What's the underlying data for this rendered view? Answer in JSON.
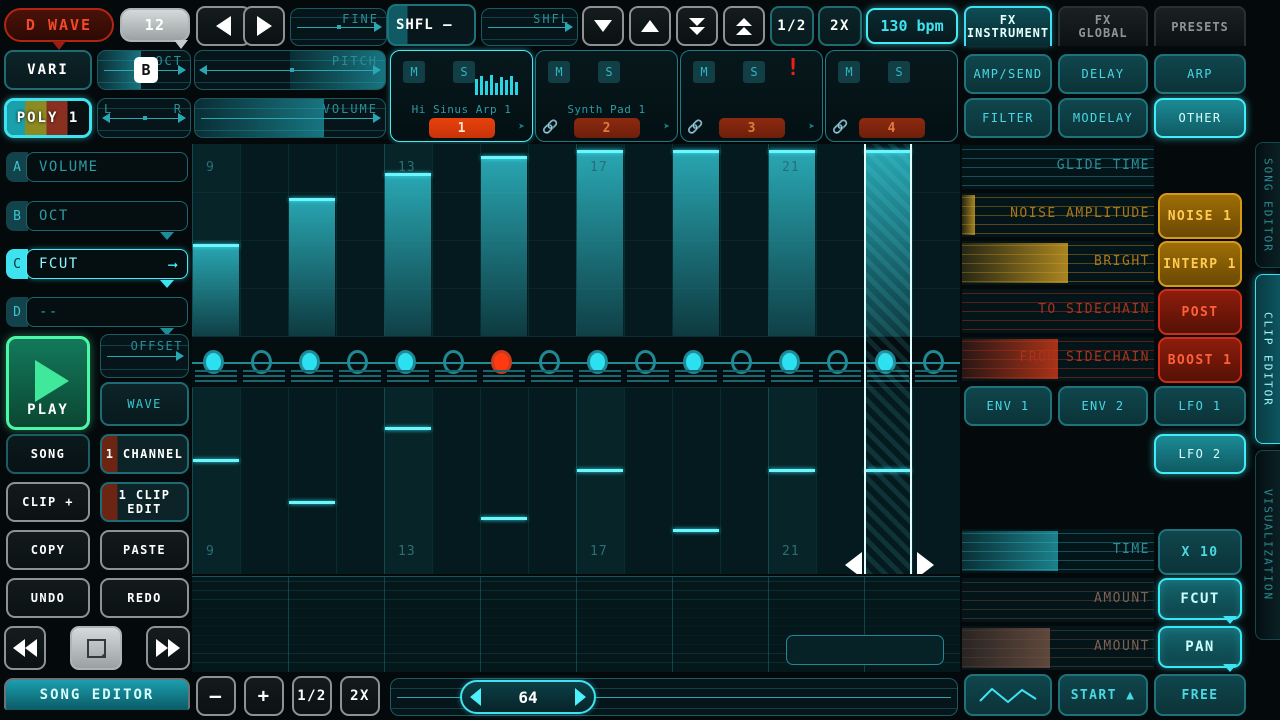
{
  "colors": {
    "cyan": "#2fd8e0",
    "bright_cyan": "#44ecf8",
    "amber": "#f0ad25",
    "red": "#f24a28",
    "green": "#46f2a0",
    "bg": "#040a0c"
  },
  "toolbar": {
    "wave_select": "D WAVE",
    "wave_number": "12",
    "prev_icon": "arrow-left-icon",
    "next_icon": "arrow-right-icon",
    "fine_label": "FINE",
    "shuffle_button": "SHFL –",
    "shuffle_label": "SHFL",
    "down_icon": "triangle-down-icon",
    "up_icon": "triangle-up-icon",
    "dbl_down_icon": "double-triangle-down-icon",
    "dbl_up_icon": "double-triangle-up-icon",
    "half": "1/2",
    "double": "2X",
    "bpm": "130 bpm"
  },
  "instrument": {
    "vari": "VARI",
    "poly": "POLY 1",
    "key_badge": "B",
    "oct_label": "OCT",
    "pitch_label": "PITCH",
    "pan_left": "L",
    "pan_right": "R",
    "volume_label": "VOLUME",
    "offset_label": "OFFSET"
  },
  "mod_slots": [
    {
      "key": "A",
      "value": "VOLUME",
      "selected": false,
      "caret": false
    },
    {
      "key": "B",
      "value": "OCT",
      "selected": false,
      "caret": true
    },
    {
      "key": "C",
      "value": "FCUT",
      "selected": true,
      "caret": true
    },
    {
      "key": "D",
      "value": "--",
      "selected": false,
      "caret": true
    }
  ],
  "channels": [
    {
      "mute": "M",
      "solo": "S",
      "name": "Hi Sinus Arp 1",
      "clip": "1",
      "selected": true,
      "link": false,
      "next": true,
      "bang": false,
      "wave": true
    },
    {
      "mute": "M",
      "solo": "S",
      "name": "Synth Pad 1",
      "clip": "2",
      "selected": false,
      "link": true,
      "next": true,
      "bang": false,
      "wave": false
    },
    {
      "mute": "M",
      "solo": "S",
      "name": "",
      "clip": "3",
      "selected": false,
      "link": true,
      "next": true,
      "bang": true,
      "wave": false
    },
    {
      "mute": "M",
      "solo": "S",
      "name": "",
      "clip": "4",
      "selected": false,
      "link": true,
      "next": false,
      "bang": false,
      "wave": false
    }
  ],
  "left_panel": {
    "play": "PLAY",
    "play_icon": "play-triangle-icon",
    "wave": "WAVE",
    "song": "SONG",
    "channel": "1 CHANNEL",
    "clip_add": "CLIP +",
    "clip_edit": "1 CLIP EDIT",
    "copy": "COPY",
    "paste": "PASTE",
    "undo": "UNDO",
    "redo": "REDO",
    "rew_icon": "rewind-icon",
    "ffwd_icon": "fast-forward-icon",
    "stop_icon": "stop-square-icon",
    "song_editor": "SONG EDITOR"
  },
  "fx_tabs": [
    {
      "label": "FX\nINSTRUMENT",
      "line1": "FX",
      "line2": "INSTRUMENT",
      "active": true
    },
    {
      "label": "FX GLOBAL",
      "line1": "FX",
      "line2": "GLOBAL",
      "active": false
    },
    {
      "label": "PRESETS",
      "line1": "PRESETS",
      "line2": "",
      "active": false
    }
  ],
  "fx_buttons": [
    {
      "label": "AMP/SEND",
      "active": false
    },
    {
      "label": "DELAY",
      "active": false
    },
    {
      "label": "ARP",
      "active": false
    },
    {
      "label": "FILTER",
      "active": false
    },
    {
      "label": "MODELAY",
      "active": false
    },
    {
      "label": "OTHER",
      "active": true
    }
  ],
  "fx_params": [
    {
      "label": "GLIDE TIME",
      "fill": 0.0,
      "color": "cyan",
      "button": null
    },
    {
      "label": "NOISE AMPLITUDE",
      "fill": 0.07,
      "color": "amber",
      "button": {
        "label": "NOISE 1",
        "style": "amberfill"
      }
    },
    {
      "label": "BRIGHT",
      "fill": 0.55,
      "color": "amber",
      "button": {
        "label": "INTERP 1",
        "style": "amberfill"
      }
    },
    {
      "label": "TO SIDECHAIN",
      "fill": 0.0,
      "color": "red",
      "button": {
        "label": "POST",
        "style": "redfill"
      }
    },
    {
      "label": "FROM SIDECHAIN",
      "fill": 0.5,
      "color": "red",
      "button": {
        "label": "BOOST 1",
        "style": "redfill"
      }
    }
  ],
  "env_buttons": [
    {
      "label": "ENV 1",
      "active": false
    },
    {
      "label": "ENV 2",
      "active": false
    },
    {
      "label": "LFO 1",
      "active": false
    },
    {
      "label": "LFO 2",
      "active": true
    }
  ],
  "lfo_params": [
    {
      "label": "TIME",
      "fill": 0.5,
      "color": "cyan",
      "button": {
        "label": "X 10",
        "style": "teal",
        "caret": false
      }
    },
    {
      "label": "AMOUNT",
      "fill": 0.0,
      "color": "warm",
      "button": {
        "label": "FCUT",
        "style": "active",
        "caret": true
      }
    },
    {
      "label": "AMOUNT",
      "fill": 0.46,
      "color": "warm",
      "button": {
        "label": "PAN",
        "style": "active",
        "caret": true
      }
    }
  ],
  "lfo_footer": [
    {
      "label": "",
      "icon": "waveform-triangle-icon",
      "active": false
    },
    {
      "label": "START ▲",
      "icon": "",
      "active": false
    },
    {
      "label": "FREE",
      "icon": "",
      "active": false
    }
  ],
  "right_tabs": [
    {
      "label": "SONG EDITOR",
      "active": false
    },
    {
      "label": "CLIP EDITOR",
      "active": true
    },
    {
      "label": "VISUALIZATION",
      "active": false
    }
  ],
  "grid": {
    "bar_labels": [
      {
        "text": "9",
        "col": 0
      },
      {
        "text": "13",
        "col": 4
      },
      {
        "text": "17",
        "col": 8
      },
      {
        "text": "21",
        "col": 12
      }
    ],
    "steps": [
      {
        "i": 0,
        "state": "on"
      },
      {
        "i": 1,
        "state": "off"
      },
      {
        "i": 2,
        "state": "on"
      },
      {
        "i": 3,
        "state": "off"
      },
      {
        "i": 4,
        "state": "on"
      },
      {
        "i": 5,
        "state": "off"
      },
      {
        "i": 6,
        "state": "accent"
      },
      {
        "i": 7,
        "state": "off"
      },
      {
        "i": 8,
        "state": "on"
      },
      {
        "i": 9,
        "state": "off"
      },
      {
        "i": 10,
        "state": "on"
      },
      {
        "i": 11,
        "state": "off"
      },
      {
        "i": 12,
        "state": "on"
      },
      {
        "i": 13,
        "state": "off"
      },
      {
        "i": 14,
        "state": "on"
      },
      {
        "i": 15,
        "state": "off"
      }
    ],
    "velocity_bars": [
      {
        "col": 0,
        "top": 0.52
      },
      {
        "col": 2,
        "top": 0.28
      },
      {
        "col": 4,
        "top": 0.15
      },
      {
        "col": 6,
        "top": 0.06
      },
      {
        "col": 8,
        "top": 0.03
      },
      {
        "col": 10,
        "top": 0.03
      },
      {
        "col": 12,
        "top": 0.03
      },
      {
        "col": 14,
        "top": 0.03
      }
    ],
    "notes": [
      {
        "col": 0,
        "pitch": 0.62
      },
      {
        "col": 2,
        "pitch": 0.38
      },
      {
        "col": 4,
        "pitch": 0.8
      },
      {
        "col": 6,
        "pitch": 0.29
      },
      {
        "col": 8,
        "pitch": 0.56
      },
      {
        "col": 10,
        "pitch": 0.22
      },
      {
        "col": 12,
        "pitch": 0.56
      },
      {
        "col": 14,
        "pitch": 0.56
      }
    ],
    "playhead_col": 14,
    "nav_left_icon": "triangle-left-icon",
    "nav_right_icon": "triangle-right-icon"
  },
  "bottom_bar": {
    "minus": "–",
    "plus": "+",
    "half": "1/2",
    "double": "2X",
    "length_value": "64",
    "length_left_icon": "triangle-left-icon",
    "length_right_icon": "triangle-right-icon"
  }
}
